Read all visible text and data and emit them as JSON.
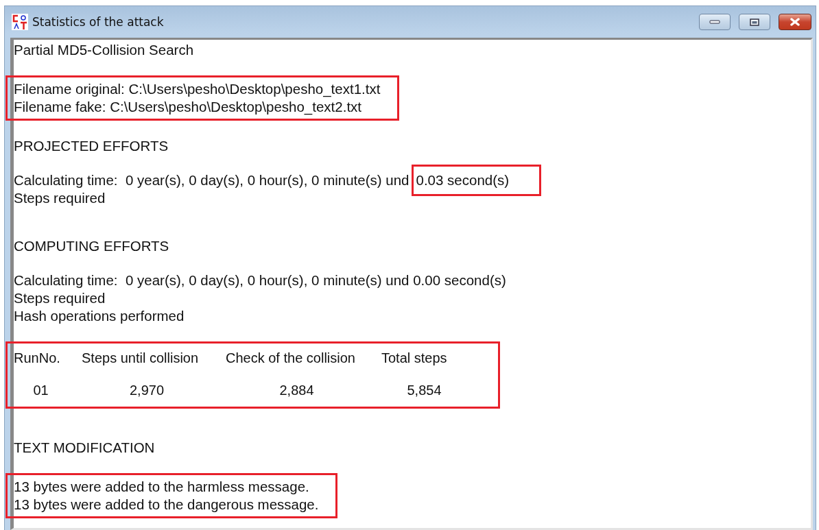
{
  "window": {
    "title": "Statistics of the attack"
  },
  "report": [
    {
      "kind": "title",
      "highlighted": false,
      "lines": [
        {
          "text": "Partial MD5-Collision Search"
        }
      ]
    },
    {
      "kind": "text",
      "highlighted": true,
      "lines": [
        {
          "text": "Filename original: C:\\Users\\pesho\\Desktop\\pesho_text1.txt"
        },
        {
          "text": "Filename fake: C:\\Users\\pesho\\Desktop\\pesho_text2.txt"
        }
      ]
    },
    {
      "kind": "text",
      "highlighted": false,
      "lines": [
        {
          "text": "PROJECTED EFFORTS"
        }
      ]
    },
    {
      "kind": "text",
      "highlighted": false,
      "lines": [
        {
          "text": "Calculating time:  0 year(s), 0 day(s), 0 hour(s), 0 minute(s) und",
          "mark": "0.03 second(s)"
        },
        {
          "text": "Steps required"
        }
      ]
    },
    {
      "kind": "heading",
      "highlighted": false,
      "lines": [
        {
          "text": "COMPUTING EFFORTS"
        }
      ]
    },
    {
      "kind": "text",
      "highlighted": false,
      "lines": [
        {
          "text": "Calculating time:  0 year(s), 0 day(s), 0 hour(s), 0 minute(s) und 0.00 second(s)"
        },
        {
          "text": "Steps required"
        },
        {
          "text": "Hash operations performed"
        }
      ]
    },
    {
      "kind": "text",
      "highlighted": true,
      "table": {
        "columns": [
          "RunNo.",
          "Steps until collision",
          "Check of the collision",
          "Total steps"
        ],
        "rows": [
          [
            "01",
            "2,970",
            "2,884",
            "5,854"
          ]
        ]
      }
    },
    {
      "kind": "heading",
      "highlighted": false,
      "lines": [
        {
          "text": "TEXT MODIFICATION"
        }
      ]
    },
    {
      "kind": "text",
      "highlighted": true,
      "lines": [
        {
          "text": "13 bytes were added to the harmless message."
        },
        {
          "text": "13 bytes were added to the dangerous message."
        }
      ]
    }
  ]
}
